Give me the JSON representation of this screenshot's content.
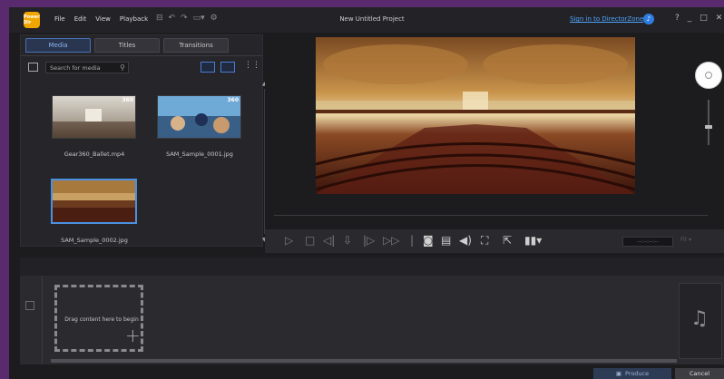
{
  "app": {
    "logo_text": "Power Dir",
    "project_title": "New Untitled Project",
    "signin_link": "Sign in to DirectorZone"
  },
  "menu": [
    "File",
    "Edit",
    "View",
    "Playback"
  ],
  "window_controls": [
    "?",
    "_",
    "□",
    "✕"
  ],
  "media": {
    "tabs": [
      {
        "label": "Media",
        "active": true
      },
      {
        "label": "Titles",
        "active": false
      },
      {
        "label": "Transitions",
        "active": false
      }
    ],
    "search_placeholder": "Search for media",
    "items": [
      {
        "name": "Gear360_Ballet.mp4",
        "badge": "360",
        "selected": false
      },
      {
        "name": "SAM_Sample_0001.jpg",
        "badge": "360",
        "selected": false
      },
      {
        "name": "SAM_Sample_0002.jpg",
        "badge": "",
        "selected": true
      }
    ]
  },
  "preview": {
    "timecode": "--:--:--:--",
    "fit": "Fit"
  },
  "timeline": {
    "drop_label": "Drag content here to begin"
  },
  "buttons": {
    "produce": "Produce",
    "cancel": "Cancel"
  },
  "colors": {
    "accent": "#4a90e2",
    "link": "#4da3ff",
    "logo": "#f0a500"
  }
}
